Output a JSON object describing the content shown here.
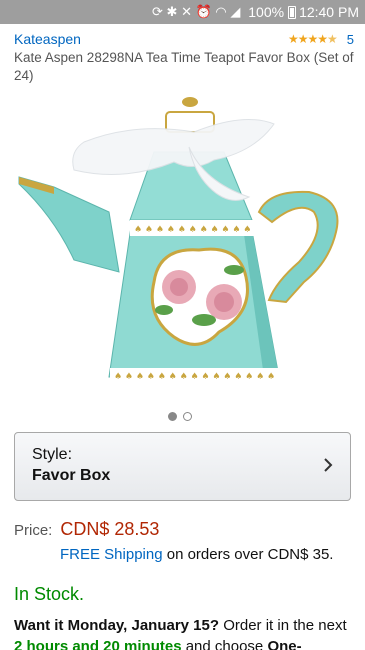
{
  "status_bar": {
    "battery": "100%",
    "time": "12:40 PM",
    "icons": [
      "sync-icon",
      "bluetooth-icon",
      "mute-icon",
      "alarm-icon",
      "wifi-icon",
      "signal-icon",
      "battery-icon"
    ]
  },
  "product": {
    "brand": "Kateaspen",
    "rating_count": "5",
    "rating_stars": 4.5,
    "title": "Kate Aspen 28298NA Tea Time Teapot Favor Box (Set of 24)"
  },
  "gallery": {
    "total": 2,
    "active_index": 0
  },
  "style": {
    "label": "Style:",
    "value": "Favor Box"
  },
  "price": {
    "label": "Price:",
    "value": "CDN$ 28.53"
  },
  "shipping": {
    "link_text": "FREE Shipping",
    "rest": " on orders over CDN$ 35."
  },
  "stock": {
    "text": "In Stock."
  },
  "delivery": {
    "want_it": "Want it Monday, January 15?",
    "order_in": " Order it in the next ",
    "time_left": "2 hours and 20 minutes",
    "and_choose": " and choose ",
    "one_day": "One-"
  },
  "colors": {
    "link": "#0066c0",
    "price": "#b12704",
    "in_stock": "#008a00",
    "star": "#f0a51e"
  }
}
